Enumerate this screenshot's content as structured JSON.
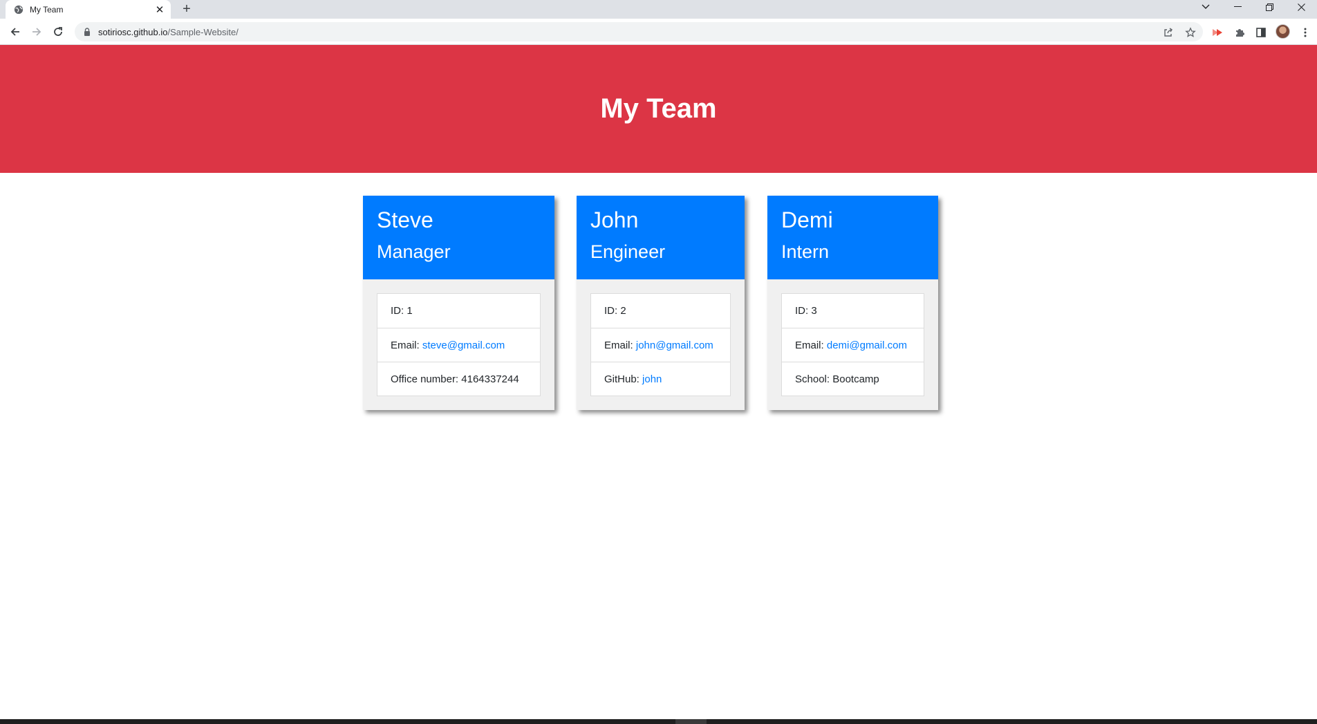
{
  "browser": {
    "tab_title": "My Team",
    "new_tab_label": "+",
    "url_host": "sotiriosc.github.io",
    "url_path": "/Sample-Website/"
  },
  "page": {
    "title": "My Team"
  },
  "team": [
    {
      "name": "Steve",
      "role": "Manager",
      "id_label": "ID: ",
      "id": "1",
      "email_label": "Email: ",
      "email": "steve@gmail.com",
      "extra_label": "Office number: ",
      "extra_value": "4164337244"
    },
    {
      "name": "John",
      "role": "Engineer",
      "id_label": "ID: ",
      "id": "2",
      "email_label": "Email: ",
      "email": "john@gmail.com",
      "extra_label": "GitHub: ",
      "extra_value": "john"
    },
    {
      "name": "Demi",
      "role": "Intern",
      "id_label": "ID: ",
      "id": "3",
      "email_label": "Email: ",
      "email": "demi@gmail.com",
      "extra_label": "School: ",
      "extra_value": "Bootcamp"
    }
  ],
  "colors": {
    "jumbotron": "#dc3545",
    "card_header": "#007bff",
    "link": "#007bff"
  },
  "icons": {
    "favicon": "globe-icon",
    "tab_close": "close-icon",
    "back": "back-arrow-icon",
    "forward": "forward-arrow-icon",
    "reload": "reload-icon",
    "lock": "lock-icon",
    "share": "share-icon",
    "bookmark": "star-icon",
    "extension_red": "extension-icon",
    "extensions": "puzzle-icon",
    "side_panel": "side-panel-icon",
    "profile": "avatar",
    "menu": "kebab-menu-icon"
  }
}
